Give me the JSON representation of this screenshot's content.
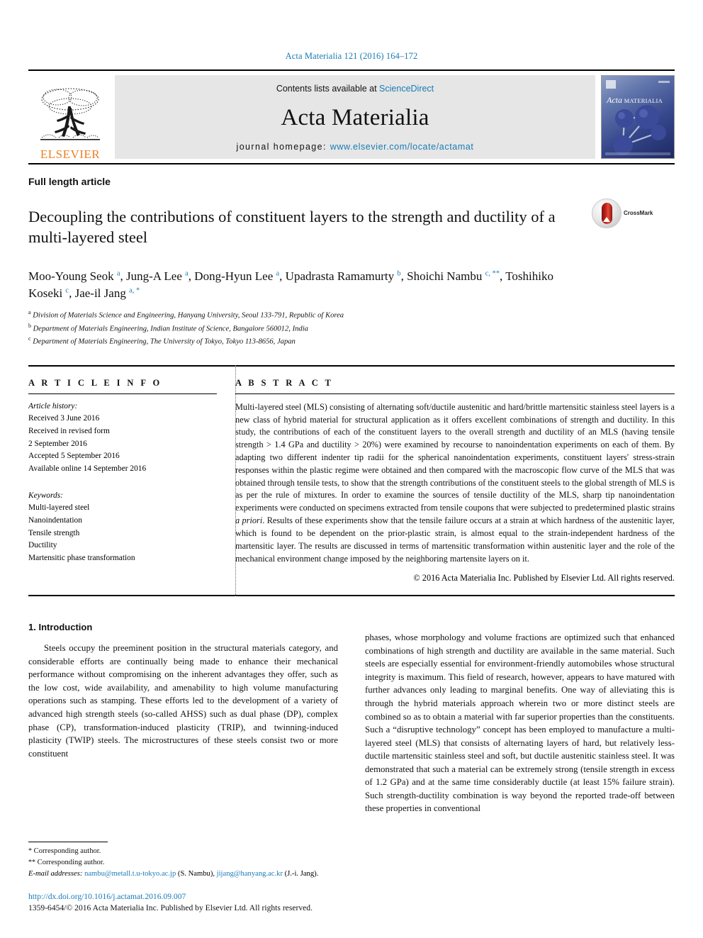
{
  "running_head": "Acta Materialia 121 (2016) 164–172",
  "masthead": {
    "publisher_name": "ELSEVIER",
    "contents_prefix": "Contents lists available at ",
    "contents_link": "ScienceDirect",
    "journal_title": "Acta Materialia",
    "homepage_prefix": "journal homepage: ",
    "homepage_url": "www.elsevier.com/locate/actamat",
    "cover": {
      "title_italic": "Acta",
      "title_caps": "MATERIALIA"
    },
    "link_color": "#1a7bb5",
    "elsevier_orange": "#ee7f22"
  },
  "article_type": "Full length article",
  "title": "Decoupling the contributions of constituent layers to the strength and ductility of a multi-layered steel",
  "crossmark_label": "CrossMark",
  "authors_html": "Moo-Young Seok <sup>a</sup>, Jung-A Lee <sup>a</sup>, Dong-Hyun Lee <sup>a</sup>, Upadrasta Ramamurty <sup>b</sup>, Shoichi Nambu <sup>c, **</sup>, Toshihiko Koseki <sup>c</sup>, Jae-il Jang <sup>a, *</sup>",
  "affiliations": [
    {
      "mark": "a",
      "text": "Division of Materials Science and Engineering, Hanyang University, Seoul 133-791, Republic of Korea"
    },
    {
      "mark": "b",
      "text": "Department of Materials Engineering, Indian Institute of Science, Bangalore 560012, India"
    },
    {
      "mark": "c",
      "text": "Department of Materials Engineering, The University of Tokyo, Tokyo 113-8656, Japan"
    }
  ],
  "article_info": {
    "heading": "A R T I C L E   I N F O",
    "history_label": "Article history:",
    "history": [
      "Received 3 June 2016",
      "Received in revised form",
      "2 September 2016",
      "Accepted 5 September 2016",
      "Available online 14 September 2016"
    ],
    "keywords_label": "Keywords:",
    "keywords": [
      "Multi-layered steel",
      "Nanoindentation",
      "Tensile strength",
      "Ductility",
      "Martensitic phase transformation"
    ]
  },
  "abstract": {
    "heading": "A B S T R A C T",
    "body": "Multi-layered steel (MLS) consisting of alternating soft/ductile austenitic and hard/brittle martensitic stainless steel layers is a new class of hybrid material for structural application as it offers excellent combinations of strength and ductility. In this study, the contributions of each of the constituent layers to the overall strength and ductility of an MLS (having tensile strength > 1.4 GPa and ductility > 20%) were examined by recourse to nanoindentation experiments on each of them. By adapting two different indenter tip radii for the spherical nanoindentation experiments, constituent layers' stress-strain responses within the plastic regime were obtained and then compared with the macroscopic flow curve of the MLS that was obtained through tensile tests, to show that the strength contributions of the constituent steels to the global strength of MLS is as per the rule of mixtures. In order to examine the sources of tensile ductility of the MLS, sharp tip nanoindentation experiments were conducted on specimens extracted from tensile coupons that were subjected to predetermined plastic strains ",
    "body_italic": "a priori",
    "body_tail": ". Results of these experiments show that the tensile failure occurs at a strain at which hardness of the austenitic layer, which is found to be dependent on the prior-plastic strain, is almost equal to the strain-independent hardness of the martensitic layer. The results are discussed in terms of martensitic transformation within austenitic layer and the role of the mechanical environment change imposed by the neighboring martensite layers on it.",
    "copyright": "© 2016 Acta Materialia Inc. Published by Elsevier Ltd. All rights reserved."
  },
  "introduction": {
    "heading": "1. Introduction",
    "left_paragraph": "Steels occupy the preeminent position in the structural materials category, and considerable efforts are continually being made to enhance their mechanical performance without compromising on the inherent advantages they offer, such as the low cost, wide availability, and amenability to high volume manufacturing operations such as stamping. These efforts led to the development of a variety of advanced high strength steels (so-called AHSS) such as dual phase (DP), complex phase (CP), transformation-induced plasticity (TRIP), and twinning-induced plasticity (TWIP) steels. The microstructures of these steels consist two or more constituent",
    "right_paragraph": "phases, whose morphology and volume fractions are optimized such that enhanced combinations of high strength and ductility are available in the same material. Such steels are especially essential for environment-friendly automobiles whose structural integrity is maximum. This field of research, however, appears to have matured with further advances only leading to marginal benefits. One way of alleviating this is through the hybrid materials approach wherein two or more distinct steels are combined so as to obtain a material with far superior properties than the constituents. Such a “disruptive technology” concept has been employed to manufacture a multi-layered steel (MLS) that consists of alternating layers of hard, but relatively less-ductile martensitic stainless steel and soft, but ductile austenitic stainless steel. It was demonstrated that such a material can be extremely strong (tensile strength in excess of 1.2 GPa) and at the same time considerably ductile (at least 15% failure strain). Such strength-ductility combination is way beyond the reported trade-off between these properties in conventional"
  },
  "footnotes": {
    "corresponding_1": "Corresponding author.",
    "corresponding_2": "Corresponding author.",
    "email_label": "E-mail addresses:",
    "email_1": "nambu@metall.t.u-tokyo.ac.jp",
    "email_1_owner": "(S. Nambu),",
    "email_2": "jijang@hanyang.ac.kr",
    "email_2_owner": "(J.-i. Jang).",
    "doi": "http://dx.doi.org/10.1016/j.actamat.2016.09.007",
    "issn": "1359-6454/© 2016 Acta Materialia Inc. Published by Elsevier Ltd. All rights reserved."
  }
}
